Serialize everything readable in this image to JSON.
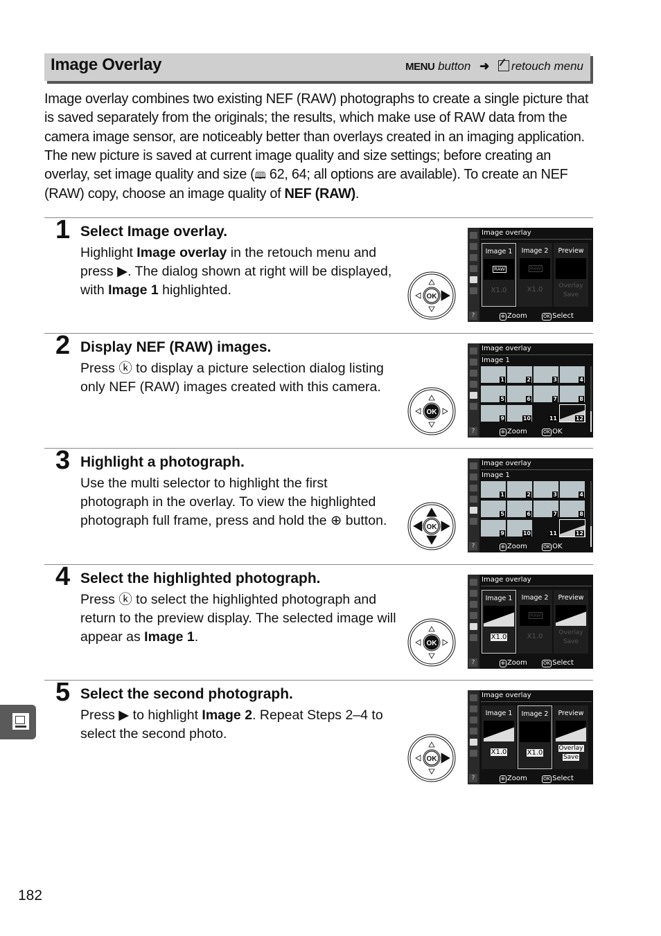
{
  "header": {
    "title": "Image Overlay",
    "menu_word": "MENU",
    "button_word": "button",
    "arrow": "➜",
    "retouch_label": "retouch menu"
  },
  "intro": {
    "text_1": "Image overlay combines two existing NEF (RAW) photographs to create a single picture that is saved separately from the originals; the results, which make use of RAW data from the camera image sensor, are noticeably better than overlays created in an imaging application.  The new picture is saved at current image quality and size settings; before creating an overlay, set image quality and size (",
    "page_ref_icon": "📖",
    "text_2": " 62, 64; all options are available).  To create an NEF (RAW) copy, choose an image quality of ",
    "bold_end": "NEF (RAW)",
    "text_3": "."
  },
  "steps": [
    {
      "number": "1",
      "heading_pre": "Select ",
      "heading_bold": "Image overlay.",
      "body": [
        {
          "t": "Highlight "
        },
        {
          "b": "Image overlay"
        },
        {
          "t": " in the retouch menu and press ▶.  The dialog shown at right will be displayed, with "
        },
        {
          "b": "Image 1"
        },
        {
          "t": " highlighted."
        }
      ],
      "selector_active": "right"
    },
    {
      "number": "2",
      "heading_pre": "Display NEF (RAW) images.",
      "heading_bold": "",
      "body": [
        {
          "t": "Press ⓚ to display a picture selection dialog listing only NEF (RAW) images created with this camera."
        }
      ],
      "selector_active": "ok"
    },
    {
      "number": "3",
      "heading_pre": "Highlight a photograph.",
      "heading_bold": "",
      "body": [
        {
          "t": "Use the multi selector to highlight the first photograph in the overlay.  To view the highlighted photograph full frame, press and hold the ⊕ button."
        }
      ],
      "selector_active": "all-directions"
    },
    {
      "number": "4",
      "heading_pre": "Select the highlighted photograph.",
      "heading_bold": "",
      "body": [
        {
          "t": "Press ⓚ to select the highlighted photograph and return to the preview display.  The selected image will appear as "
        },
        {
          "b": "Image 1"
        },
        {
          "t": "."
        }
      ],
      "selector_active": "ok"
    },
    {
      "number": "5",
      "heading_pre": "Select the second photograph.",
      "heading_bold": "",
      "body": [
        {
          "t": "Press ▶ to highlight "
        },
        {
          "b": "Image 2"
        },
        {
          "t": ".  Repeat Steps 2–4 to select the second photo."
        }
      ],
      "selector_active": "right"
    }
  ],
  "lcd": {
    "title": "Image overlay",
    "image1": "Image 1",
    "image2": "Image 2",
    "preview": "Preview",
    "raw": "RAW",
    "gain": "X1.0",
    "overlay": "Overlay",
    "save": "Save",
    "zoom": "Zoom",
    "select": "Select",
    "ok": "OK",
    "help": "?",
    "thumb_numbers": [
      "1",
      "2",
      "3",
      "4",
      "5",
      "6",
      "7",
      "8",
      "9",
      "10",
      "11",
      "12"
    ]
  },
  "selector_ok_label": "OK",
  "page_number": "182"
}
